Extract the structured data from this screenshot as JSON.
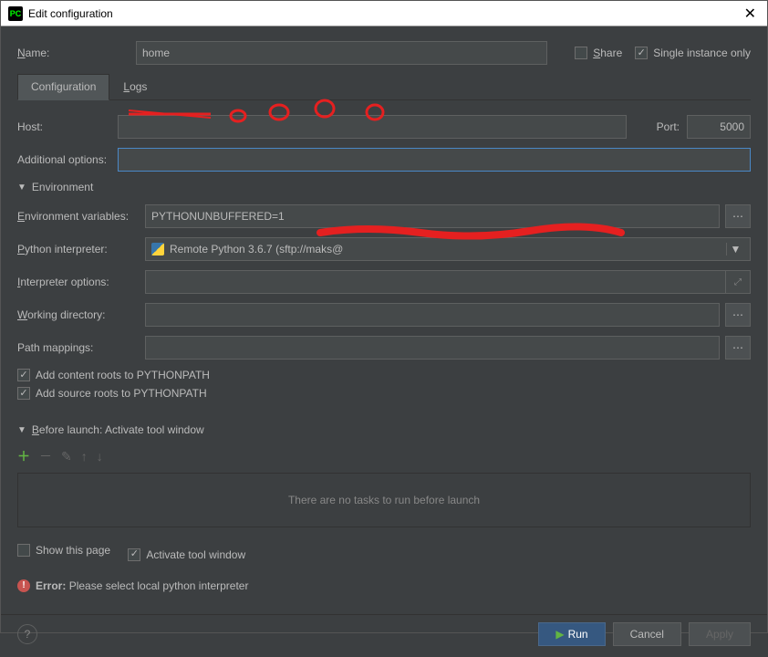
{
  "window": {
    "title": "Edit configuration"
  },
  "header": {
    "name_label": "Name:",
    "name_value": "home",
    "share_label": "Share",
    "single_instance_label": "Single instance only"
  },
  "tabs": {
    "configuration": "Configuration",
    "logs": "Logs"
  },
  "config": {
    "host_label": "Host:",
    "host_value": "",
    "port_label": "Port:",
    "port_value": "5000",
    "additional_options_label": "Additional options:",
    "additional_options_value": ""
  },
  "environment": {
    "section_title": "Environment",
    "env_vars_label": "Environment variables:",
    "env_vars_value": "PYTHONUNBUFFERED=1",
    "interpreter_label": "Python interpreter:",
    "interpreter_value": "Remote Python 3.6.7 (sftp://maks@",
    "interpreter_options_label": "Interpreter options:",
    "interpreter_options_value": "",
    "working_dir_label": "Working directory:",
    "working_dir_value": "",
    "path_mappings_label": "Path mappings:",
    "path_mappings_value": "",
    "add_content_roots": "Add content roots to PYTHONPATH",
    "add_source_roots": "Add source roots to PYTHONPATH"
  },
  "before_launch": {
    "section_title": "Before launch: Activate tool window",
    "no_tasks": "There are no tasks to run before launch",
    "show_this_page": "Show this page",
    "activate_tool_window": "Activate tool window"
  },
  "error": {
    "label": "Error:",
    "message": "Please select local python interpreter"
  },
  "buttons": {
    "run": "Run",
    "cancel": "Cancel",
    "apply": "Apply"
  }
}
